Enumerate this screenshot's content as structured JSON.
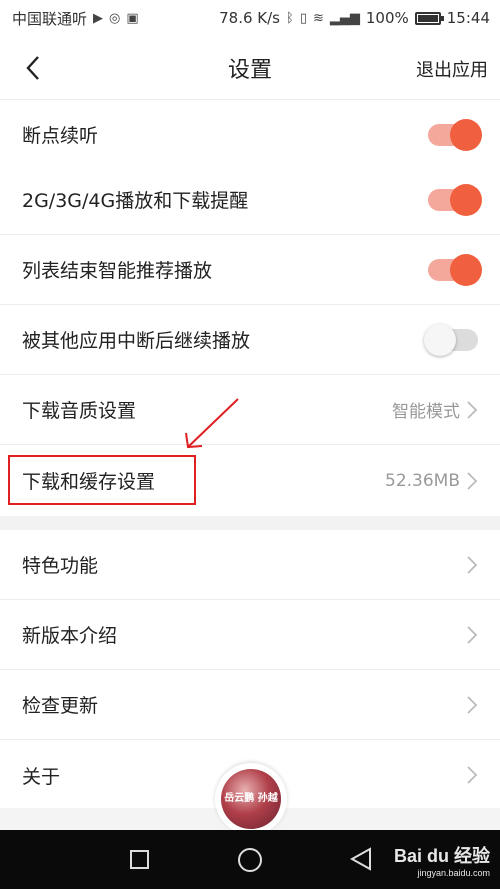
{
  "status_bar": {
    "carrier": "中国联通听",
    "network_speed": "78.6 K/s",
    "battery": "100%",
    "time": "15:44"
  },
  "header": {
    "title": "设置",
    "exit_label": "退出应用"
  },
  "settings": {
    "rows": [
      {
        "label": "断点续听",
        "toggle": true
      },
      {
        "label": "2G/3G/4G播放和下载提醒",
        "toggle": true
      },
      {
        "label": "列表结束智能推荐播放",
        "toggle": true
      },
      {
        "label": "被其他应用中断后继续播放",
        "toggle": false
      },
      {
        "label": "下载音质设置",
        "value": "智能模式"
      },
      {
        "label": "下载和缓存设置",
        "value": "52.36MB"
      }
    ],
    "more_rows": [
      {
        "label": "特色功能"
      },
      {
        "label": "新版本介绍"
      },
      {
        "label": "检查更新"
      },
      {
        "label": "关于"
      }
    ]
  },
  "player": {
    "cover_text": "岳云鹏 孙越"
  },
  "watermark": {
    "brand": "Bai du 经验",
    "sub": "jingyan.baidu.com"
  },
  "colors": {
    "accent": "#f0603f",
    "toggle_track_on": "#f4a89b",
    "annotation_red": "#e02020"
  }
}
